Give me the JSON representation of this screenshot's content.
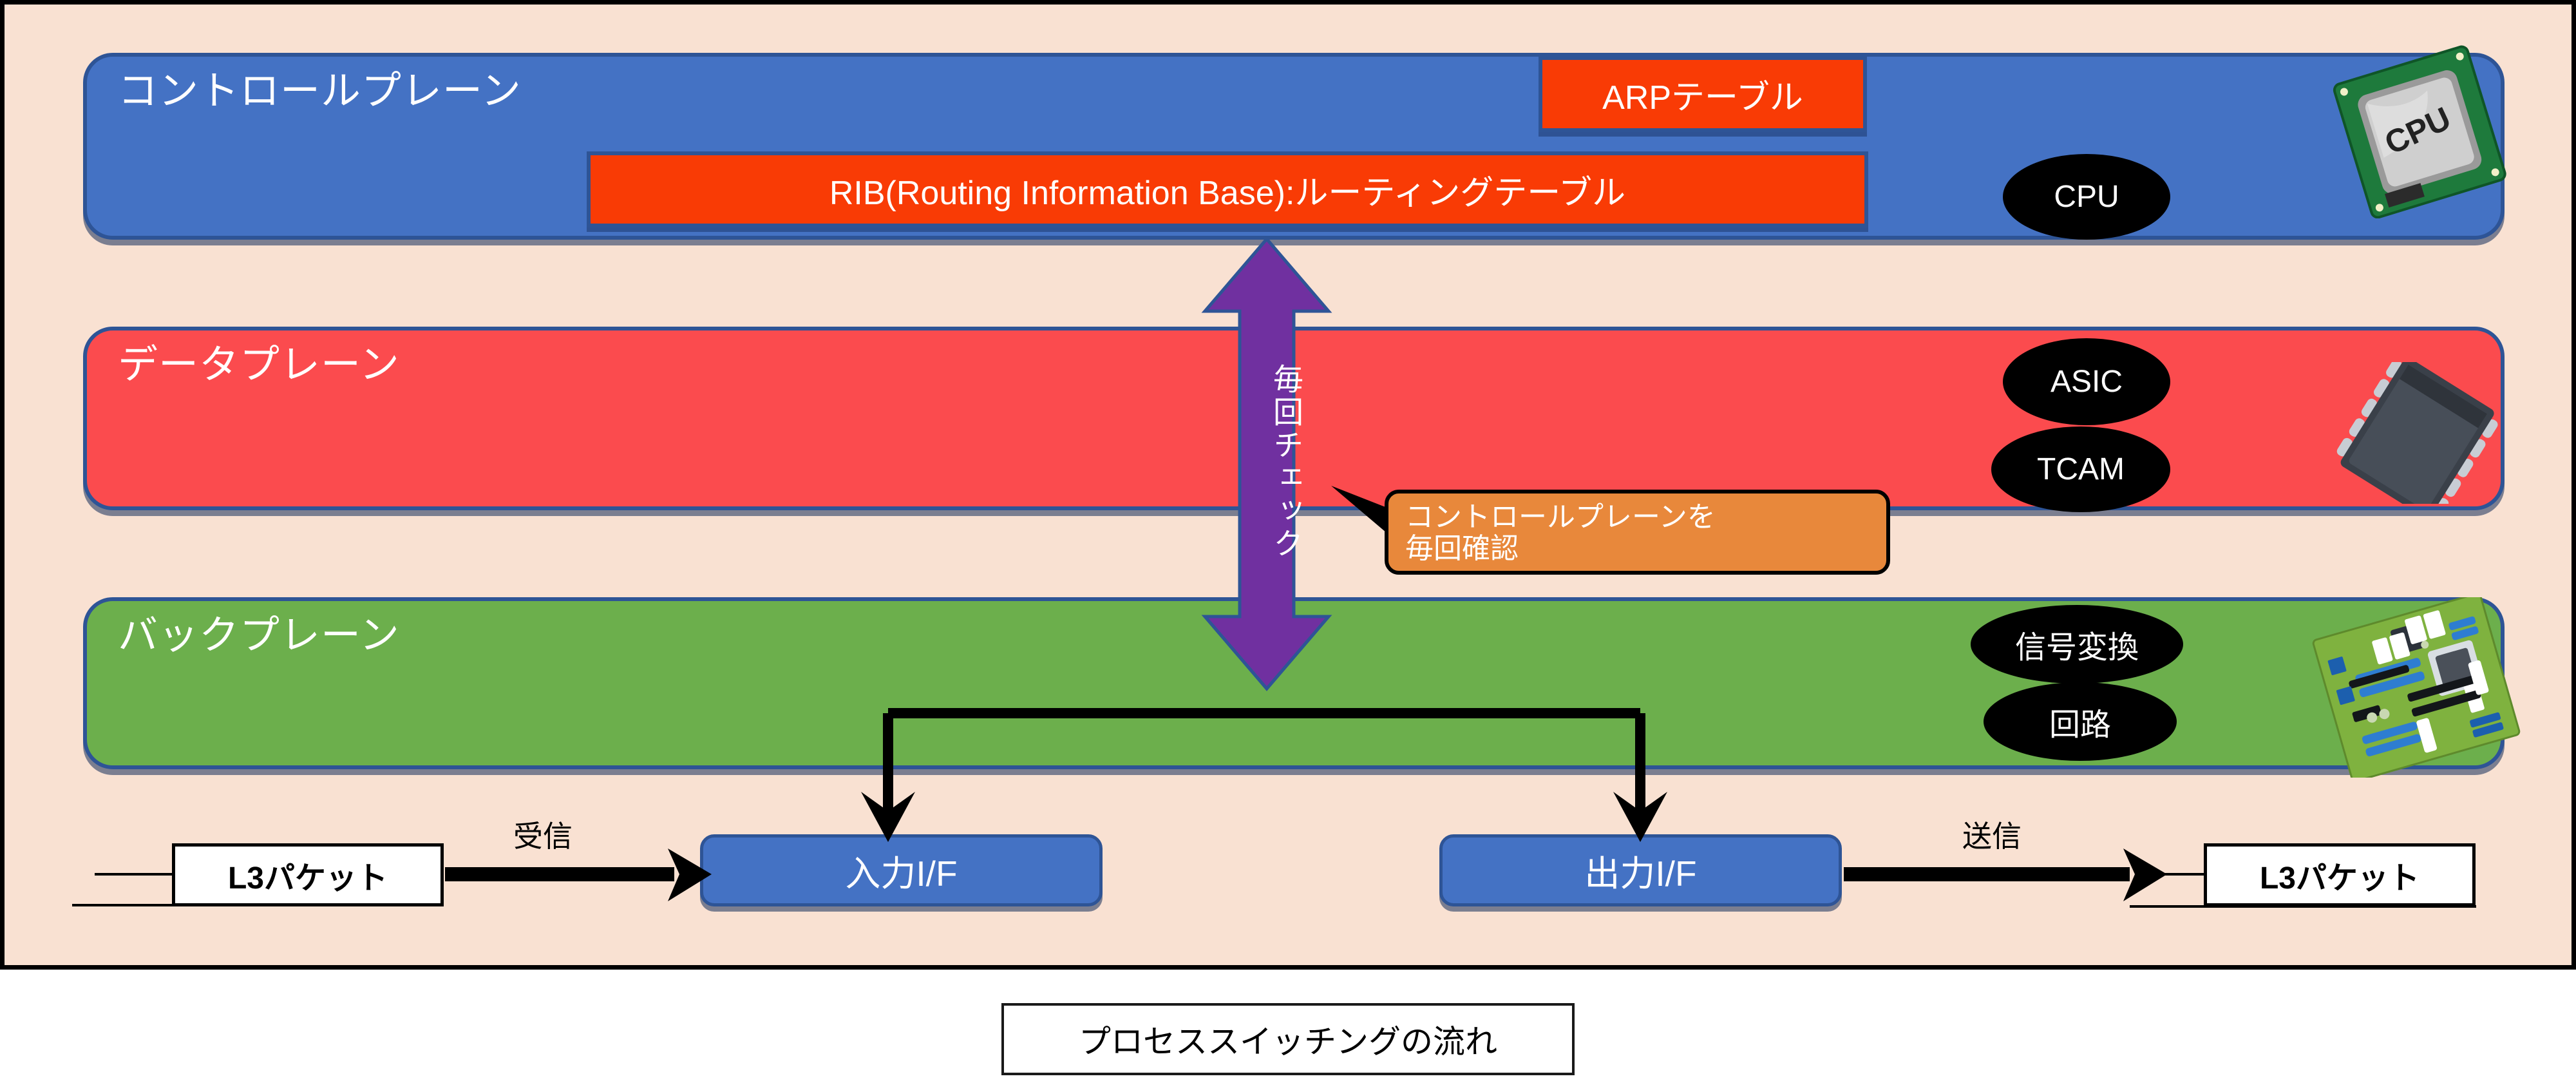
{
  "diagram": {
    "caption": "プロセススイッチングの流れ",
    "background_color": "#F9E1D2",
    "planes": [
      {
        "id": "control-plane",
        "label": "コントロールプレーン",
        "color": "#4472C4",
        "border_color": "#2E5496"
      },
      {
        "id": "data-plane",
        "label": "データプレーン",
        "color": "#FB4B4E",
        "border_color": "#2E5496"
      },
      {
        "id": "back-plane",
        "label": "バックプレーン",
        "color": "#6CAF4C",
        "border_color": "#2E5496"
      }
    ],
    "tables": [
      {
        "id": "arp-table",
        "label": "ARPテーブル",
        "color": "#F93B05"
      },
      {
        "id": "rib-table",
        "label": "RIB(Routing Information Base):ルーティングテーブル",
        "color": "#F93B05"
      }
    ],
    "tags": [
      {
        "id": "cpu-tag",
        "label": "CPU",
        "plane": "control-plane"
      },
      {
        "id": "asic-tag",
        "label": "ASIC",
        "plane": "data-plane"
      },
      {
        "id": "tcam-tag",
        "label": "TCAM",
        "plane": "data-plane"
      },
      {
        "id": "signal-tag",
        "label": "信号変換",
        "plane": "back-plane"
      },
      {
        "id": "circuit-tag",
        "label": "回路",
        "plane": "back-plane"
      }
    ],
    "pictograms": [
      {
        "id": "cpu-pict",
        "name": "cpu-chip-image",
        "text": "CPU"
      },
      {
        "id": "chip-pict",
        "name": "asic-dip-chip-image"
      },
      {
        "id": "board-pict",
        "name": "circuit-board-image"
      }
    ],
    "check_arrow": {
      "label": "毎回チェック",
      "color": "#7030A0",
      "direction": "bidirectional-vertical"
    },
    "callout": {
      "text": "コントロールプレーンを\n毎回確認",
      "color": "#E8883B"
    },
    "flow": {
      "packet_in_label": "L3パケット",
      "packet_out_label": "L3パケット",
      "receive_label": "受信",
      "send_label": "送信",
      "input_if_label": "入力I/F",
      "output_if_label": "出力I/F"
    }
  }
}
